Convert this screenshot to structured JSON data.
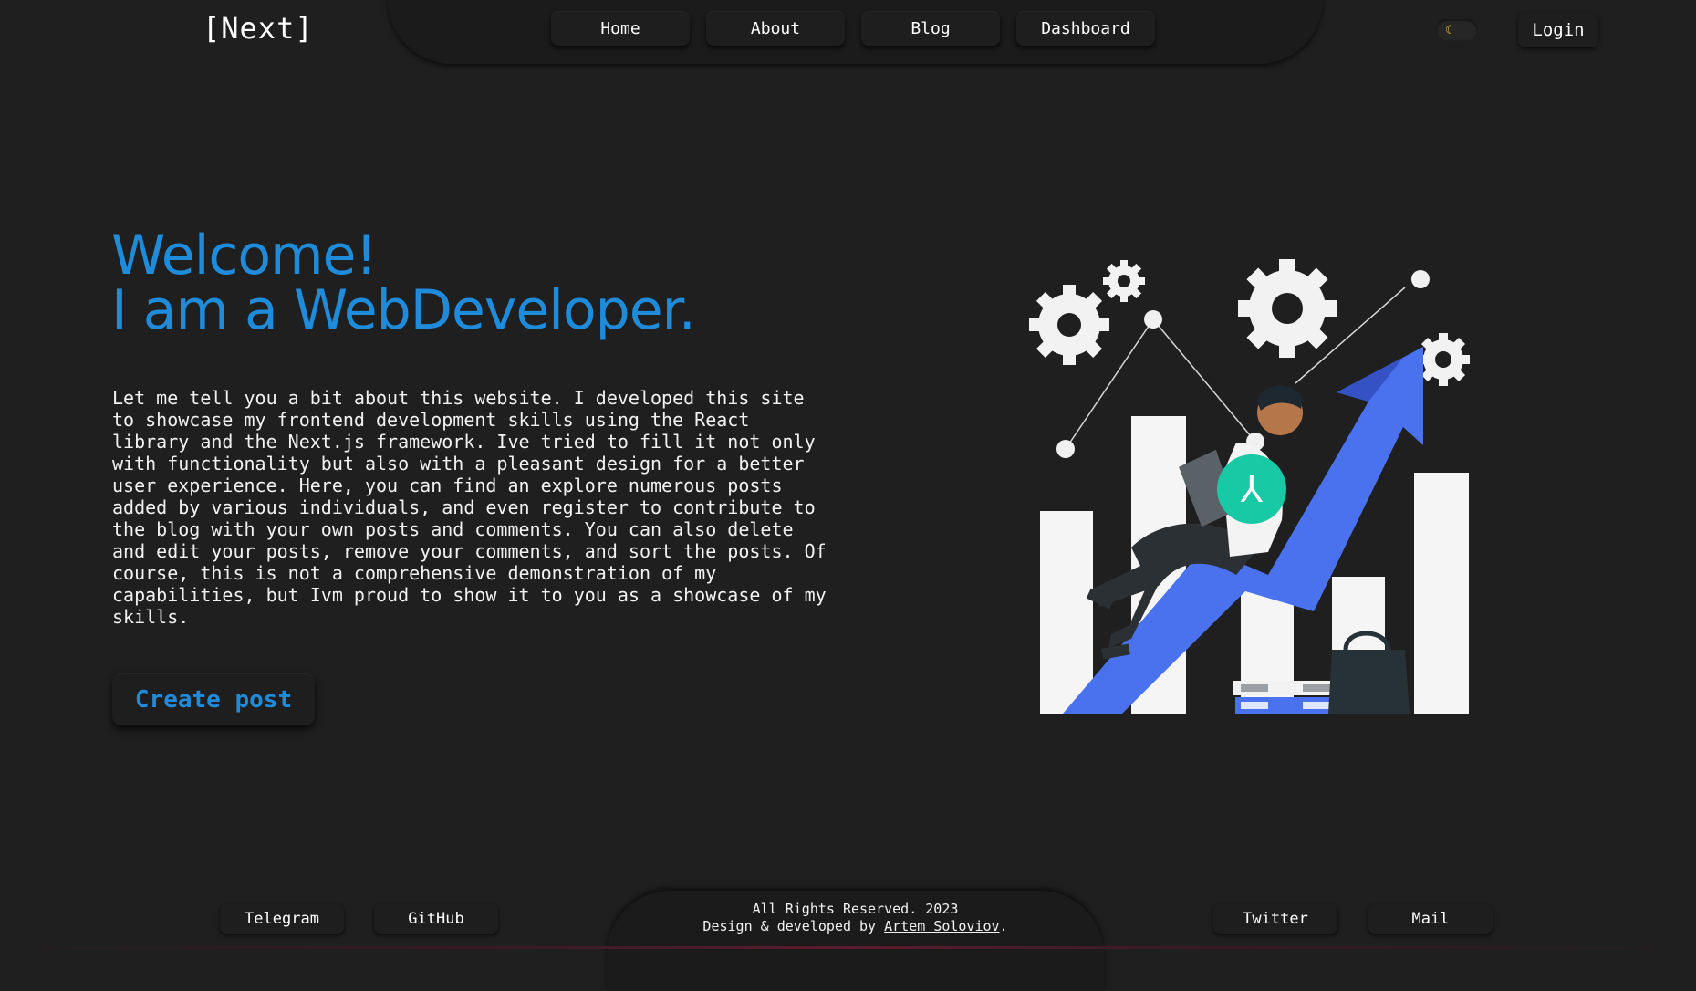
{
  "header": {
    "logo": "[Next]",
    "nav": [
      {
        "label": "Home"
      },
      {
        "label": "About"
      },
      {
        "label": "Blog"
      },
      {
        "label": "Dashboard"
      }
    ],
    "theme_icon": "moon-icon",
    "login_label": "Login"
  },
  "hero": {
    "title_line1": "Welcome!",
    "title_line2": "I am a WebDeveloper.",
    "description": "Let me tell you a bit about this website. I developed this site to showcase my frontend development skills using the React library and the Next.js framework. Ive tried to fill it not only with functionality but also with a pleasant design for a better user experience. Here, you can find an explore numerous posts added by various individuals, and even register to contribute to the blog with your own posts and comments. You can also delete and edit your posts, remove your comments, and sort the posts. Of course, this is not a comprehensive demonstration of my capabilities, but Ivm proud to show it to you as a showcase of my skills.",
    "create_post_label": "Create post",
    "illustration_icon": "growth-illustration"
  },
  "footer": {
    "social": [
      {
        "label": "Telegram"
      },
      {
        "label": "GitHub"
      },
      {
        "label": "Twitter"
      },
      {
        "label": "Mail"
      }
    ],
    "copyright": "All Rights Reserved. 2023",
    "credit_prefix": "Design & developed by",
    "author": "Artem Soloviov",
    "credit_suffix": "."
  },
  "colors": {
    "accent": "#1e8cdb",
    "background": "#1f1f1f",
    "arrow": "#4a72ee",
    "teal": "#18c9a6"
  }
}
